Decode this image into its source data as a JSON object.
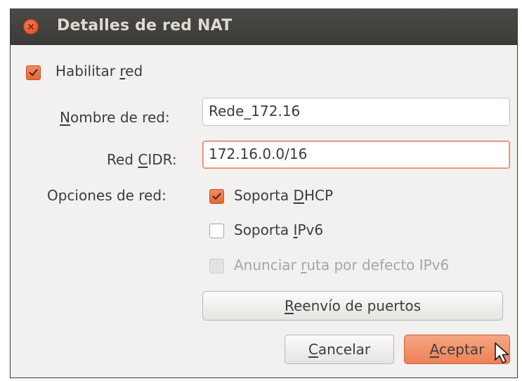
{
  "window": {
    "title": "Detalles de red NAT"
  },
  "enable_network": {
    "label_pre": "Habilitar ",
    "label_u": "r",
    "label_post": "ed",
    "checked": true
  },
  "network_name": {
    "label_pre": "",
    "label_u": "N",
    "label_post": "ombre de red:",
    "value": "Rede_172.16"
  },
  "network_cidr": {
    "label_pre": "Red ",
    "label_u": "C",
    "label_post": "IDR:",
    "value": "172.16.0.0/16"
  },
  "network_options": {
    "label": "Opciones de red:",
    "dhcp": {
      "label_pre": "Soporta ",
      "label_u": "D",
      "label_post": "HCP",
      "checked": true
    },
    "ipv6": {
      "label_pre": "Soporta ",
      "label_u": "I",
      "label_post": "Pv6",
      "checked": false
    },
    "default_route": {
      "label_pre": "Anunciar ",
      "label_u": "r",
      "label_post": "uta por defecto IPv6",
      "checked": false,
      "enabled": false
    }
  },
  "buttons": {
    "port_forwarding": {
      "pre": "",
      "u": "R",
      "post": "eenvío de puertos"
    },
    "cancel": {
      "pre": "",
      "u": "C",
      "post": "ancelar"
    },
    "accept": {
      "pre": "",
      "u": "A",
      "post": "ceptar"
    }
  },
  "colors": {
    "accent": "#e36a3c",
    "titlebar": "#3c3b37",
    "background": "#f2f1f0"
  }
}
